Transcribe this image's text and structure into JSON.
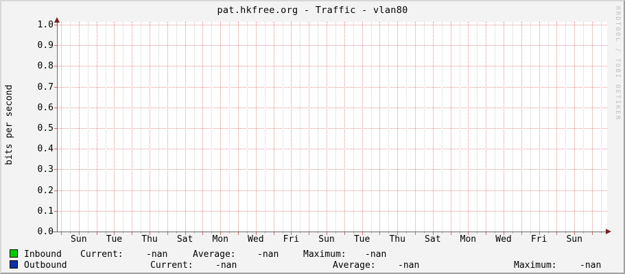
{
  "title": "pat.hkfree.org - Traffic - vlan80",
  "watermark": "RRDTOOL / TOBI OETIKER",
  "chart_data": {
    "type": "line",
    "title": "pat.hkfree.org - Traffic - vlan80",
    "xlabel": "",
    "ylabel": "bits per second",
    "ylim": [
      0.0,
      1.0
    ],
    "y_tick_step": 0.1,
    "y_ticks": [
      "0.0",
      "0.1",
      "0.2",
      "0.3",
      "0.4",
      "0.5",
      "0.6",
      "0.7",
      "0.8",
      "0.9",
      "1.0"
    ],
    "x_tick_labels": [
      "Sun",
      "Tue",
      "Thu",
      "Sat",
      "Mon",
      "Wed",
      "Fri",
      "Sun",
      "Tue",
      "Thu",
      "Sat",
      "Mon",
      "Wed",
      "Fri",
      "Sun"
    ],
    "grid": {
      "on": true,
      "major_color": "#e08d8d",
      "minor_color": "#cfcfcf",
      "style": "dotted"
    },
    "legend_position": "bottom-left",
    "series": [
      {
        "name": "Inbound",
        "color": "#00CC00",
        "values": [],
        "current": "-nan",
        "average": "-nan",
        "maximum": "-nan"
      },
      {
        "name": "Outbound",
        "color": "#0B32A8",
        "values": [],
        "current": "-nan",
        "average": "-nan",
        "maximum": "-nan"
      }
    ],
    "note": "no data plotted; all series values are -nan"
  },
  "legend": {
    "rows": [
      {
        "swatch_color": "#00CC00",
        "label": "Inbound",
        "current_label": "Current:",
        "current_value": "-nan",
        "average_label": "Average:",
        "average_value": "-nan",
        "maximum_label": "Maximum:",
        "maximum_value": "-nan"
      },
      {
        "swatch_color": "#0B32A8",
        "label": "Outbound",
        "current_label": "Current:",
        "current_value": "-nan",
        "average_label": "Average:",
        "average_value": "-nan",
        "maximum_label": "Maximum:",
        "maximum_value": "-nan"
      }
    ]
  }
}
